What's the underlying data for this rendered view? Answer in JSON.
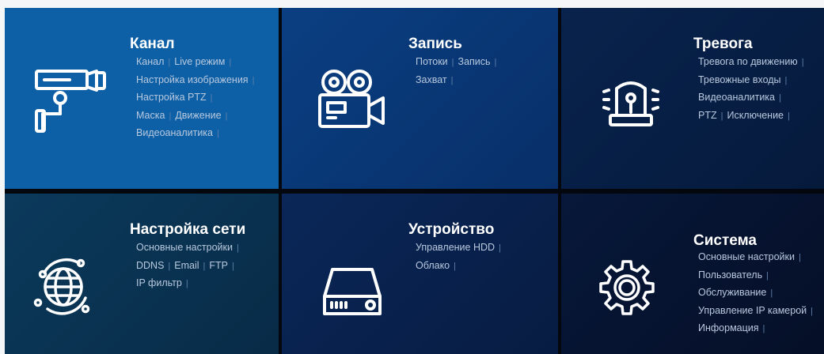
{
  "tiles": [
    {
      "title": "Канал",
      "icon": "camera-icon",
      "rows": [
        [
          "Канал",
          "Live режим"
        ],
        [
          "Настройка изображения"
        ],
        [
          "Настройка PTZ"
        ],
        [
          "Маска",
          "Движение"
        ],
        [
          "Видеоаналитика"
        ]
      ]
    },
    {
      "title": "Запись",
      "icon": "video-camera-icon",
      "rows": [
        [
          "Потоки",
          "Запись"
        ],
        [
          "Захват"
        ]
      ]
    },
    {
      "title": "Тревога",
      "icon": "alarm-beacon-icon",
      "rows": [
        [
          "Тревога по движению"
        ],
        [
          "Тревожные входы"
        ],
        [
          "Видеоаналитика"
        ],
        [
          "PTZ",
          "Исключение"
        ]
      ]
    },
    {
      "title": "Настройка сети",
      "icon": "globe-network-icon",
      "rows": [
        [
          "Основные настройки"
        ],
        [
          "DDNS",
          "Email",
          "FTP"
        ],
        [
          "IP фильтр"
        ]
      ]
    },
    {
      "title": "Устройство",
      "icon": "hdd-device-icon",
      "rows": [
        [
          "Управление HDD"
        ],
        [
          "Облако"
        ]
      ]
    },
    {
      "title": "Система",
      "icon": "gear-icon",
      "rows": [
        [
          "Основные настройки"
        ],
        [
          "Пользователь"
        ],
        [
          "Обслуживание"
        ],
        [
          "Управление IP камерой"
        ],
        [
          "Информация"
        ]
      ]
    }
  ],
  "colors": {
    "title": "#ffffff",
    "link": "#b9c9de",
    "separator": "#5f7fa8",
    "channel_tile": "#0d5fa6"
  }
}
